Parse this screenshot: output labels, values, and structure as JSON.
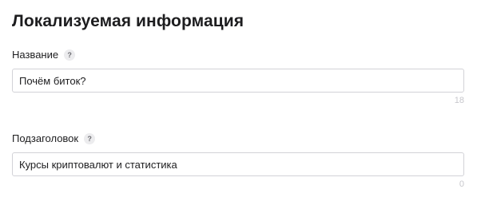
{
  "section": {
    "title": "Локализуемая информация"
  },
  "fields": {
    "name": {
      "label": "Название",
      "help": "?",
      "value": "Почём биток?",
      "remaining": "18"
    },
    "subtitle": {
      "label": "Подзаголовок",
      "help": "?",
      "value": "Курсы криптовалют и статистика",
      "remaining": "0"
    }
  }
}
